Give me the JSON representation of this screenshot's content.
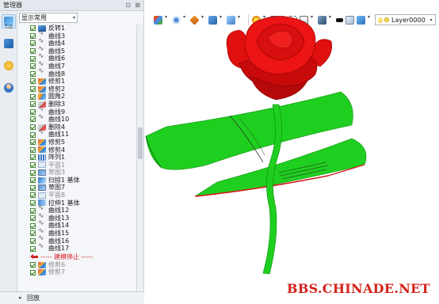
{
  "panel": {
    "title": "管理器",
    "pin_glyph": "⊡",
    "close_glyph": "⊠",
    "side_tab_sub": "T-D",
    "filter_value": "显示常用",
    "playback_label": "回放"
  },
  "tree": {
    "items": [
      {
        "label": "反转1",
        "icon": "ext-icon",
        "cls": "ext"
      },
      {
        "label": "曲线3",
        "icon": "curve-icon",
        "cls": "curve"
      },
      {
        "label": "曲线4",
        "icon": "curve-icon",
        "cls": "curve"
      },
      {
        "label": "曲线5",
        "icon": "curve-icon",
        "cls": "curve"
      },
      {
        "label": "曲线6",
        "icon": "curve-icon",
        "cls": "curve"
      },
      {
        "label": "曲线7",
        "icon": "curve-icon",
        "cls": "curve"
      },
      {
        "label": "曲线8",
        "icon": "curve-icon",
        "cls": "curve"
      },
      {
        "label": "修剪1",
        "icon": "trim-icon",
        "cls": "trim"
      },
      {
        "label": "修剪2",
        "icon": "trim-icon",
        "cls": "trim"
      },
      {
        "label": "圆角2",
        "icon": "fillet-icon",
        "cls": "fillet"
      },
      {
        "label": "删除3",
        "icon": "delete-icon",
        "cls": "delete"
      },
      {
        "label": "曲线9",
        "icon": "curve-icon",
        "cls": "curve"
      },
      {
        "label": "曲线10",
        "icon": "curve-icon",
        "cls": "curve"
      },
      {
        "label": "删除4",
        "icon": "delete-icon",
        "cls": "delete"
      },
      {
        "label": "曲线11",
        "icon": "curve-icon",
        "cls": "curve"
      },
      {
        "label": "修剪5",
        "icon": "trim-icon",
        "cls": "trim"
      },
      {
        "label": "修剪4",
        "icon": "trim-icon",
        "cls": "trim"
      },
      {
        "label": "阵列1",
        "icon": "array-icon",
        "cls": "array"
      },
      {
        "label": "平面1",
        "icon": "plane-icon",
        "cls": "plane",
        "dim": true
      },
      {
        "label": "草图3",
        "icon": "sketch-icon",
        "cls": "sketch",
        "dim": true
      },
      {
        "label": "扫掠1 基体",
        "icon": "sweep-icon",
        "cls": "sweep"
      },
      {
        "label": "草图7",
        "icon": "sketch-icon",
        "cls": "sketch"
      },
      {
        "label": "平面8",
        "icon": "plane-icon",
        "cls": "plane",
        "dim": true
      },
      {
        "label": "拉伸1 基体",
        "icon": "stretch-icon",
        "cls": "stretch"
      },
      {
        "label": "曲线12",
        "icon": "curve-icon",
        "cls": "curve"
      },
      {
        "label": "曲线13",
        "icon": "curve-icon",
        "cls": "curve"
      },
      {
        "label": "曲线14",
        "icon": "curve-icon",
        "cls": "curve"
      },
      {
        "label": "曲线15",
        "icon": "curve-icon",
        "cls": "curve"
      },
      {
        "label": "曲线16",
        "icon": "curve-icon",
        "cls": "curve"
      },
      {
        "label": "曲线17",
        "icon": "curve-icon",
        "cls": "curve"
      },
      {
        "label": "----- 建模停止 -----",
        "icon": "rollback-arrow-icon",
        "stop": true
      },
      {
        "label": "修剪6",
        "icon": "trim-icon",
        "cls": "trim",
        "dim": true
      },
      {
        "label": "修剪7",
        "icon": "trim-icon",
        "cls": "trim",
        "dim": true
      }
    ]
  },
  "toolbar": {
    "layer_name": "Layer0000"
  },
  "watermark": "BBS.CHINADE.NET",
  "colors": {
    "rose_red": "#e01010",
    "leaf_green": "#1fcf1f",
    "stem_green": "#1fcf1f",
    "stop_red": "#d62020"
  }
}
